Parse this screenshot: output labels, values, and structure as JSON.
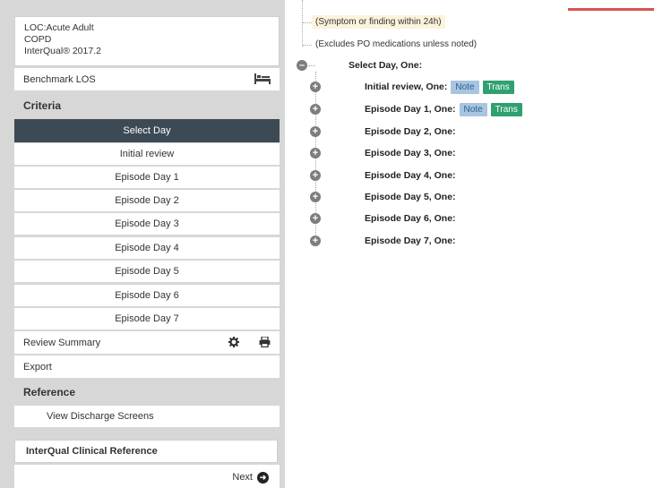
{
  "sidebar": {
    "loc": {
      "line1": "LOC:Acute Adult",
      "line2": "COPD",
      "line3": "InterQual® 2017.2"
    },
    "benchmark_los": "Benchmark LOS",
    "criteria_heading": "Criteria",
    "select_day": "Select Day",
    "subitems": [
      "Initial review",
      "Episode Day 1",
      "Episode Day 2",
      "Episode Day 3",
      "Episode Day 4",
      "Episode Day 5",
      "Episode Day 6",
      "Episode Day 7"
    ],
    "review_summary": "Review Summary",
    "export": "Export",
    "reference_heading": "Reference",
    "view_discharge": "View Discharge Screens",
    "interqual_ref": "InterQual Clinical Reference",
    "next": "Next"
  },
  "main": {
    "notes": [
      "(Symptom or finding within 24h)",
      "(Excludes PO medications unless noted)"
    ],
    "root_label": "Select Day, One:",
    "children": [
      {
        "label": "Initial review, One:",
        "note": "Note",
        "trans": "Trans"
      },
      {
        "label": "Episode Day 1, One:",
        "note": "Note",
        "trans": "Trans"
      },
      {
        "label": "Episode Day 2, One:"
      },
      {
        "label": "Episode Day 3, One:"
      },
      {
        "label": "Episode Day 4, One:"
      },
      {
        "label": "Episode Day 5, One:"
      },
      {
        "label": "Episode Day 6, One:"
      },
      {
        "label": "Episode Day 7, One:"
      }
    ]
  },
  "colors": {
    "select_day_bg": "#3c4a55",
    "note_btn": "#a8c5e0",
    "trans_btn": "#2fa06f",
    "accent_red": "#d9534f"
  }
}
